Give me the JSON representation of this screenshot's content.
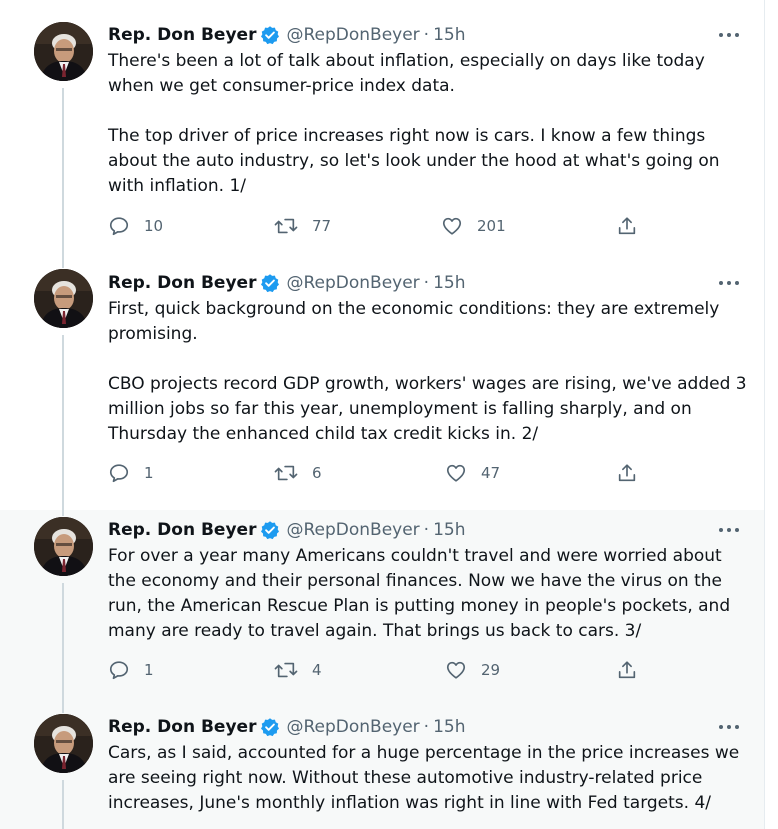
{
  "colors": {
    "verified": "#1d9bf0",
    "secondary_text": "#536471",
    "thread_line": "#cfd9de"
  },
  "icons": {
    "verified": "verified-badge-icon",
    "more": "more-dots-icon",
    "reply": "reply-icon",
    "retweet": "retweet-icon",
    "like": "like-heart-icon",
    "share": "share-icon"
  },
  "tweets": [
    {
      "name": "Rep. Don Beyer",
      "handle": "@RepDonBeyer",
      "separator": "·",
      "time": "15h",
      "paragraphs": [
        "There's been a lot of talk about inflation, especially on days like today when we get consumer-price index data.",
        "The top driver of price increases right now is cars. I know a few things about the auto industry, so let's look under the hood at what's going on with inflation. 1/"
      ],
      "replies": "10",
      "retweets": "77",
      "likes": "201"
    },
    {
      "name": "Rep. Don Beyer",
      "handle": "@RepDonBeyer",
      "separator": "·",
      "time": "15h",
      "paragraphs": [
        "First, quick background on the economic conditions: they are extremely promising.",
        "CBO projects record GDP growth, workers' wages are rising, we've added 3 million jobs so far this year, unemployment is falling sharply, and on Thursday the enhanced child tax credit kicks in. 2/"
      ],
      "replies": "1",
      "retweets": "6",
      "likes": "47"
    },
    {
      "name": "Rep. Don Beyer",
      "handle": "@RepDonBeyer",
      "separator": "·",
      "time": "15h",
      "paragraphs": [
        "For over a year many Americans couldn't travel and were worried about the economy and their personal finances. Now we have the virus on the run, the American Rescue Plan is putting money in people's pockets, and many are ready to travel again. That brings us back to cars. 3/"
      ],
      "replies": "1",
      "retweets": "4",
      "likes": "29"
    },
    {
      "name": "Rep. Don Beyer",
      "handle": "@RepDonBeyer",
      "separator": "·",
      "time": "15h",
      "paragraphs": [
        "Cars, as I said, accounted for a huge percentage in the price increases we are seeing right now. Without these automotive industry-related price increases, June's monthly inflation was right in line with Fed targets. 4/"
      ]
    }
  ]
}
